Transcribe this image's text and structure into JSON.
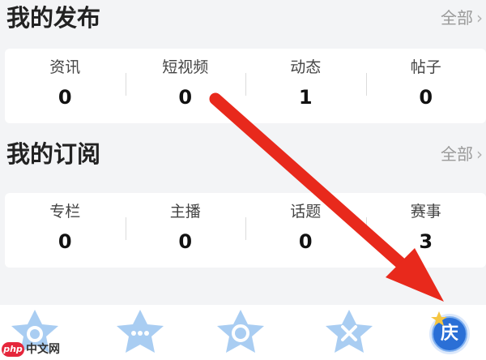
{
  "publish": {
    "title": "我的发布",
    "more_label": "全部",
    "stats": [
      {
        "label": "资讯",
        "value": "0"
      },
      {
        "label": "短视频",
        "value": "0"
      },
      {
        "label": "动态",
        "value": "1"
      },
      {
        "label": "帖子",
        "value": "0"
      }
    ]
  },
  "subscribe": {
    "title": "我的订阅",
    "more_label": "全部",
    "stats": [
      {
        "label": "专栏",
        "value": "0"
      },
      {
        "label": "主播",
        "value": "0"
      },
      {
        "label": "话题",
        "value": "0"
      },
      {
        "label": "赛事",
        "value": "3"
      }
    ]
  },
  "tabbar": {
    "special_tab_char": "庆"
  },
  "watermark": {
    "logo_text": "php",
    "site_text": "中文网"
  },
  "icons": [
    "chevron-right-icon",
    "home-star-icon",
    "chat-star-icon",
    "circle-star-icon",
    "versus-star-icon",
    "celebration-badge-icon"
  ],
  "colors": {
    "arrow": "#e8291c",
    "tab_icon": "#9ec5ef",
    "badge": "#2a6fd6",
    "background": "#f3f4f6"
  }
}
